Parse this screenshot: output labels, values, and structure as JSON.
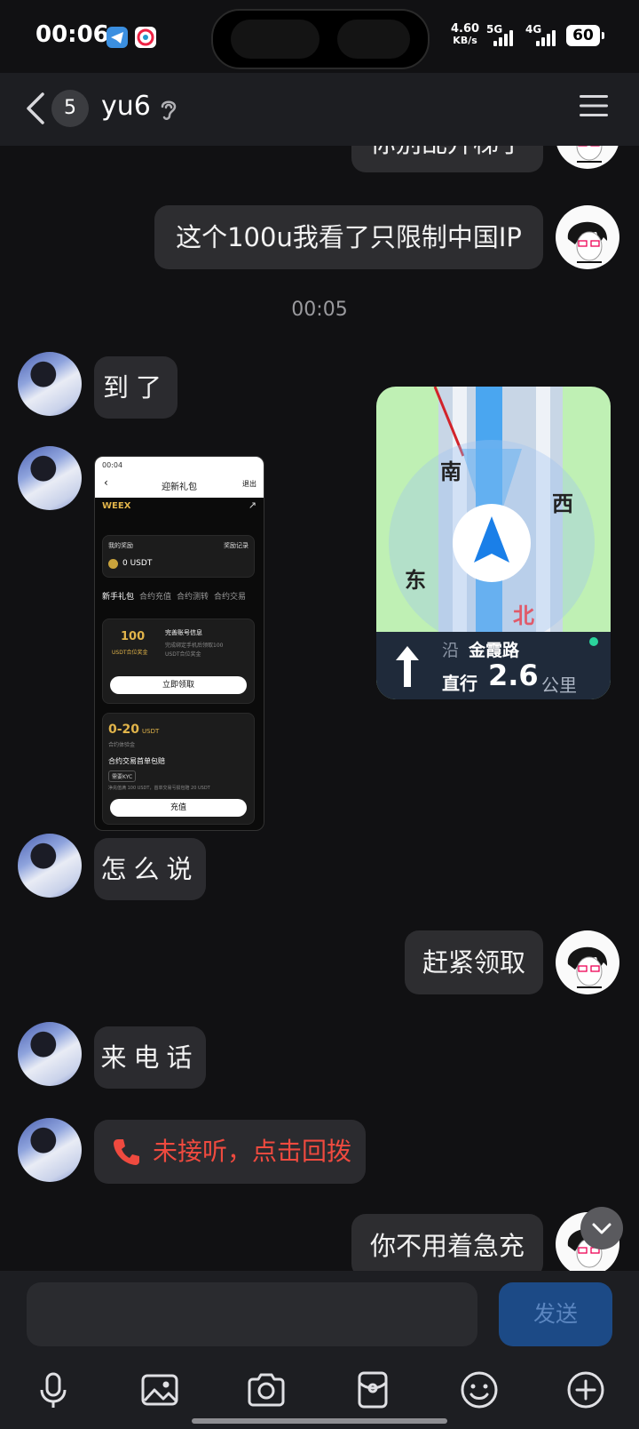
{
  "status": {
    "time": "00:06",
    "net_speed_value": "4.60",
    "net_speed_unit": "KB/s",
    "sig1": "5G",
    "sig2": "4G",
    "battery": "60"
  },
  "header": {
    "unread_count": "5",
    "title": "yu6"
  },
  "messages": {
    "m0": "你别乱升梯了",
    "m1": "这个100u我看了只限制中国IP",
    "timestamp": "00:05",
    "m2": "到了",
    "m4": "怎么说",
    "m5": "赶紧领取",
    "m6": "来电话",
    "m7": "未接听，点击回拨",
    "m8": "你不用着急充"
  },
  "screenshot": {
    "time": "00:04",
    "title": "迎新礼包",
    "right": "退出",
    "brand": "WEEX",
    "my_reward": "我的奖励",
    "reward_record": "奖励记录",
    "balance": "0 USDT",
    "tabs": [
      "新手礼包",
      "合约充值",
      "合约测转",
      "合约交易"
    ],
    "card1_amount": "100",
    "card1_unit": "USDT合位奖金",
    "card1_title": "完善账号信息",
    "card1_desc1": "完成绑定手机后领取100",
    "card1_desc2": "USDT合位奖金",
    "card1_btn": "立即领取",
    "card2_amount": "0-20",
    "card2_unit": "USDT",
    "card2_small": "合约体验金",
    "card2_title": "合约交易首单包赔",
    "card2_tag": "需要KYC",
    "card2_desc": "净充值满 100 USDT，首单交易亏损包赔 20 USDT",
    "card2_btn": "充值"
  },
  "map": {
    "south": "南",
    "west": "西",
    "east": "东",
    "north": "北",
    "road_prefix": "沿",
    "road": "金霞路",
    "direction": "直行",
    "distance": "2.6",
    "unit": "公里"
  },
  "composer": {
    "send": "发送"
  },
  "colors": {
    "background": "#111113",
    "bubble": "#2b2b2f",
    "send_button": "#1c4a86",
    "missed_call": "#ef4a3f"
  }
}
